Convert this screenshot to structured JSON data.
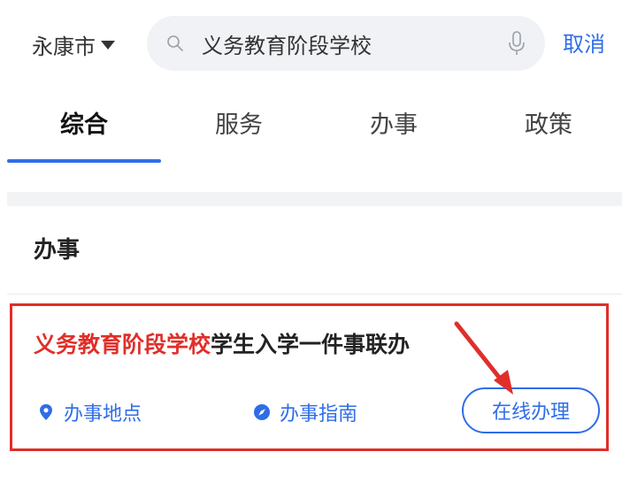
{
  "search": {
    "city": "永康市",
    "query": "义务教育阶段学校",
    "cancel_label": "取消"
  },
  "tabs": [
    {
      "label": "综合",
      "active": true
    },
    {
      "label": "服务",
      "active": false
    },
    {
      "label": "办事",
      "active": false
    },
    {
      "label": "政策",
      "active": false
    }
  ],
  "section": {
    "title": "办事"
  },
  "result": {
    "title_highlight": "义务教育阶段学校",
    "title_rest": "学生入学一件事联办",
    "location_label": "办事地点",
    "guide_label": "办事指南",
    "online_label": "在线办理"
  },
  "colors": {
    "accent": "#2f6de8",
    "highlight": "#e02f2a",
    "annotation": "#e02f2a"
  },
  "icons": [
    "search-icon",
    "mic-icon",
    "location-pin-icon",
    "compass-icon",
    "caret-down-icon"
  ]
}
